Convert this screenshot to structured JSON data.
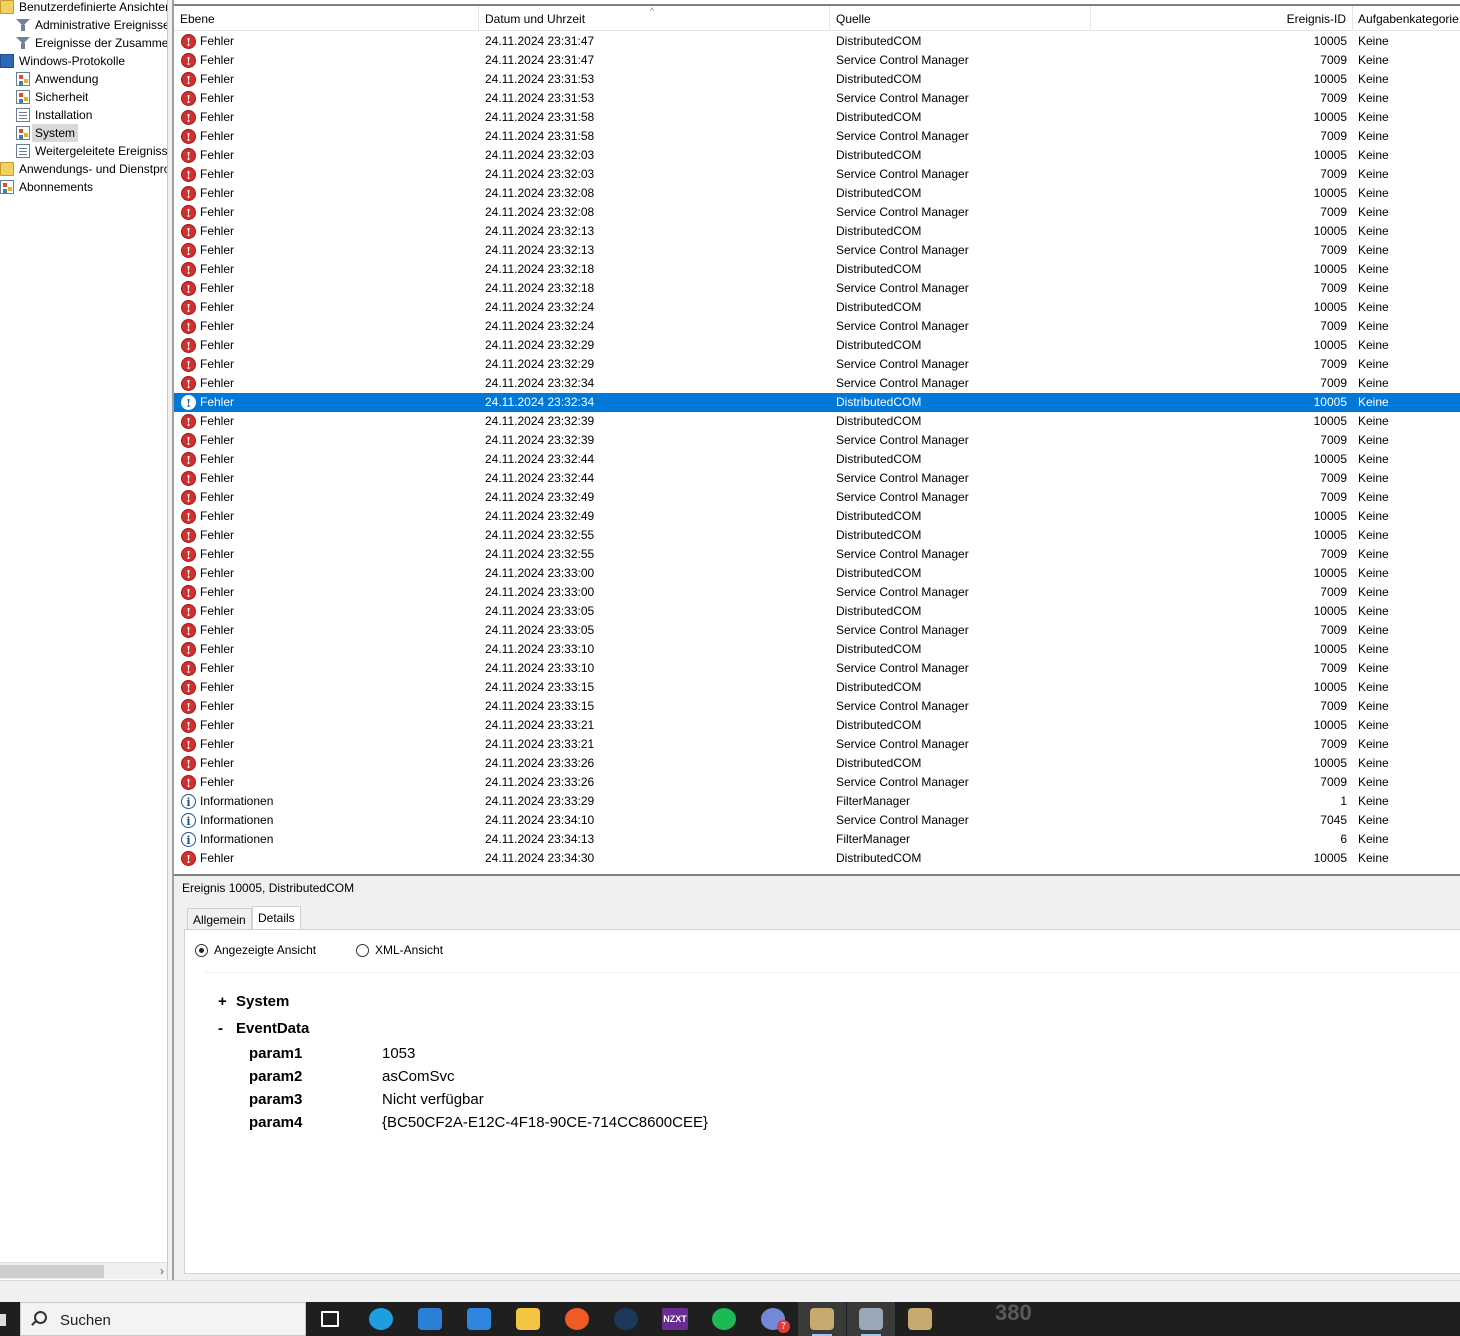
{
  "tree": {
    "items": [
      {
        "label": "Benutzerdefinierte Ansichten",
        "icon": "folder-icon"
      },
      {
        "label": "Administrative Ereignisse",
        "icon": "filter-icon"
      },
      {
        "label": "Ereignisse der Zusammen",
        "icon": "filter-icon"
      },
      {
        "label": "Windows-Protokolle",
        "icon": "windows-logs-icon"
      },
      {
        "label": "Anwendung",
        "icon": "log-icon"
      },
      {
        "label": "Sicherheit",
        "icon": "log-icon"
      },
      {
        "label": "Installation",
        "icon": "log-icon"
      },
      {
        "label": "System",
        "icon": "log-icon"
      },
      {
        "label": "Weitergeleitete Ereignisse",
        "icon": "log-icon"
      },
      {
        "label": "Anwendungs- und Dienstpro",
        "icon": "folder-icon"
      },
      {
        "label": "Abonnements",
        "icon": "log-icon"
      }
    ],
    "selected": "System",
    "scroll_arrow": "›"
  },
  "list": {
    "columns": [
      "Ebene",
      "Datum und Uhrzeit",
      "Quelle",
      "Ereignis-ID",
      "Aufgabenkategorie"
    ],
    "sort_arrow": "^",
    "selected_index": 19,
    "rows": [
      {
        "level": "Fehler",
        "date": "24.11.2024 23:31:47",
        "source": "DistributedCOM",
        "id": "10005",
        "task": "Keine"
      },
      {
        "level": "Fehler",
        "date": "24.11.2024 23:31:47",
        "source": "Service Control Manager",
        "id": "7009",
        "task": "Keine"
      },
      {
        "level": "Fehler",
        "date": "24.11.2024 23:31:53",
        "source": "DistributedCOM",
        "id": "10005",
        "task": "Keine"
      },
      {
        "level": "Fehler",
        "date": "24.11.2024 23:31:53",
        "source": "Service Control Manager",
        "id": "7009",
        "task": "Keine"
      },
      {
        "level": "Fehler",
        "date": "24.11.2024 23:31:58",
        "source": "DistributedCOM",
        "id": "10005",
        "task": "Keine"
      },
      {
        "level": "Fehler",
        "date": "24.11.2024 23:31:58",
        "source": "Service Control Manager",
        "id": "7009",
        "task": "Keine"
      },
      {
        "level": "Fehler",
        "date": "24.11.2024 23:32:03",
        "source": "DistributedCOM",
        "id": "10005",
        "task": "Keine"
      },
      {
        "level": "Fehler",
        "date": "24.11.2024 23:32:03",
        "source": "Service Control Manager",
        "id": "7009",
        "task": "Keine"
      },
      {
        "level": "Fehler",
        "date": "24.11.2024 23:32:08",
        "source": "DistributedCOM",
        "id": "10005",
        "task": "Keine"
      },
      {
        "level": "Fehler",
        "date": "24.11.2024 23:32:08",
        "source": "Service Control Manager",
        "id": "7009",
        "task": "Keine"
      },
      {
        "level": "Fehler",
        "date": "24.11.2024 23:32:13",
        "source": "DistributedCOM",
        "id": "10005",
        "task": "Keine"
      },
      {
        "level": "Fehler",
        "date": "24.11.2024 23:32:13",
        "source": "Service Control Manager",
        "id": "7009",
        "task": "Keine"
      },
      {
        "level": "Fehler",
        "date": "24.11.2024 23:32:18",
        "source": "DistributedCOM",
        "id": "10005",
        "task": "Keine"
      },
      {
        "level": "Fehler",
        "date": "24.11.2024 23:32:18",
        "source": "Service Control Manager",
        "id": "7009",
        "task": "Keine"
      },
      {
        "level": "Fehler",
        "date": "24.11.2024 23:32:24",
        "source": "DistributedCOM",
        "id": "10005",
        "task": "Keine"
      },
      {
        "level": "Fehler",
        "date": "24.11.2024 23:32:24",
        "source": "Service Control Manager",
        "id": "7009",
        "task": "Keine"
      },
      {
        "level": "Fehler",
        "date": "24.11.2024 23:32:29",
        "source": "DistributedCOM",
        "id": "10005",
        "task": "Keine"
      },
      {
        "level": "Fehler",
        "date": "24.11.2024 23:32:29",
        "source": "Service Control Manager",
        "id": "7009",
        "task": "Keine"
      },
      {
        "level": "Fehler",
        "date": "24.11.2024 23:32:34",
        "source": "Service Control Manager",
        "id": "7009",
        "task": "Keine"
      },
      {
        "level": "Fehler",
        "date": "24.11.2024 23:32:34",
        "source": "DistributedCOM",
        "id": "10005",
        "task": "Keine"
      },
      {
        "level": "Fehler",
        "date": "24.11.2024 23:32:39",
        "source": "DistributedCOM",
        "id": "10005",
        "task": "Keine"
      },
      {
        "level": "Fehler",
        "date": "24.11.2024 23:32:39",
        "source": "Service Control Manager",
        "id": "7009",
        "task": "Keine"
      },
      {
        "level": "Fehler",
        "date": "24.11.2024 23:32:44",
        "source": "DistributedCOM",
        "id": "10005",
        "task": "Keine"
      },
      {
        "level": "Fehler",
        "date": "24.11.2024 23:32:44",
        "source": "Service Control Manager",
        "id": "7009",
        "task": "Keine"
      },
      {
        "level": "Fehler",
        "date": "24.11.2024 23:32:49",
        "source": "Service Control Manager",
        "id": "7009",
        "task": "Keine"
      },
      {
        "level": "Fehler",
        "date": "24.11.2024 23:32:49",
        "source": "DistributedCOM",
        "id": "10005",
        "task": "Keine"
      },
      {
        "level": "Fehler",
        "date": "24.11.2024 23:32:55",
        "source": "DistributedCOM",
        "id": "10005",
        "task": "Keine"
      },
      {
        "level": "Fehler",
        "date": "24.11.2024 23:32:55",
        "source": "Service Control Manager",
        "id": "7009",
        "task": "Keine"
      },
      {
        "level": "Fehler",
        "date": "24.11.2024 23:33:00",
        "source": "DistributedCOM",
        "id": "10005",
        "task": "Keine"
      },
      {
        "level": "Fehler",
        "date": "24.11.2024 23:33:00",
        "source": "Service Control Manager",
        "id": "7009",
        "task": "Keine"
      },
      {
        "level": "Fehler",
        "date": "24.11.2024 23:33:05",
        "source": "DistributedCOM",
        "id": "10005",
        "task": "Keine"
      },
      {
        "level": "Fehler",
        "date": "24.11.2024 23:33:05",
        "source": "Service Control Manager",
        "id": "7009",
        "task": "Keine"
      },
      {
        "level": "Fehler",
        "date": "24.11.2024 23:33:10",
        "source": "DistributedCOM",
        "id": "10005",
        "task": "Keine"
      },
      {
        "level": "Fehler",
        "date": "24.11.2024 23:33:10",
        "source": "Service Control Manager",
        "id": "7009",
        "task": "Keine"
      },
      {
        "level": "Fehler",
        "date": "24.11.2024 23:33:15",
        "source": "DistributedCOM",
        "id": "10005",
        "task": "Keine"
      },
      {
        "level": "Fehler",
        "date": "24.11.2024 23:33:15",
        "source": "Service Control Manager",
        "id": "7009",
        "task": "Keine"
      },
      {
        "level": "Fehler",
        "date": "24.11.2024 23:33:21",
        "source": "DistributedCOM",
        "id": "10005",
        "task": "Keine"
      },
      {
        "level": "Fehler",
        "date": "24.11.2024 23:33:21",
        "source": "Service Control Manager",
        "id": "7009",
        "task": "Keine"
      },
      {
        "level": "Fehler",
        "date": "24.11.2024 23:33:26",
        "source": "DistributedCOM",
        "id": "10005",
        "task": "Keine"
      },
      {
        "level": "Fehler",
        "date": "24.11.2024 23:33:26",
        "source": "Service Control Manager",
        "id": "7009",
        "task": "Keine"
      },
      {
        "level": "Informationen",
        "date": "24.11.2024 23:33:29",
        "source": "FilterManager",
        "id": "1",
        "task": "Keine"
      },
      {
        "level": "Informationen",
        "date": "24.11.2024 23:34:10",
        "source": "Service Control Manager",
        "id": "7045",
        "task": "Keine"
      },
      {
        "level": "Informationen",
        "date": "24.11.2024 23:34:13",
        "source": "FilterManager",
        "id": "6",
        "task": "Keine"
      },
      {
        "level": "Fehler",
        "date": "24.11.2024 23:34:30",
        "source": "DistributedCOM",
        "id": "10005",
        "task": "Keine"
      }
    ]
  },
  "detail": {
    "title": "Ereignis 10005, DistributedCOM",
    "tabs": [
      "Allgemein",
      "Details"
    ],
    "active_tab": "Details",
    "radios": [
      {
        "label": "Angezeigte Ansicht",
        "checked": true
      },
      {
        "label": "XML-Ansicht",
        "checked": false
      }
    ],
    "system_section": {
      "toggle": "+",
      "label": "System"
    },
    "eventdata_section": {
      "toggle": "-",
      "label": "EventData"
    },
    "params": [
      {
        "name": "param1",
        "value": "1053"
      },
      {
        "name": "param2",
        "value": "asComSvc"
      },
      {
        "name": "param3",
        "value": "Nicht verfügbar"
      },
      {
        "name": "param4",
        "value": "{BC50CF2A-E12C-4F18-90CE-714CC8600CEE}"
      }
    ]
  },
  "taskbar": {
    "search_placeholder": "Suchen",
    "apps": [
      {
        "icon": "task-view-icon",
        "color": "#ffffff"
      },
      {
        "icon": "edge-icon",
        "color": "#1e9ee0"
      },
      {
        "icon": "store-icon",
        "color": "#2a7fd6"
      },
      {
        "icon": "mail-icon",
        "color": "#2f86e0"
      },
      {
        "icon": "explorer-icon",
        "color": "#f4c542"
      },
      {
        "icon": "firefox-icon",
        "color": "#f05a24"
      },
      {
        "icon": "steam-icon",
        "color": "#1b3a5a"
      },
      {
        "icon": "nzxt-icon",
        "color": "#6a2c91"
      },
      {
        "icon": "spotify-icon",
        "color": "#1db954"
      },
      {
        "icon": "discord-icon",
        "color": "#7289da"
      },
      {
        "icon": "league-icon",
        "color": "#c8aa6e"
      },
      {
        "icon": "event-viewer-icon",
        "color": "#9aa7b8"
      },
      {
        "icon": "league-client-icon",
        "color": "#c8aa6e"
      }
    ],
    "discord_badge": "7",
    "nzxt_label": "NZXT",
    "background_peek": "380"
  }
}
